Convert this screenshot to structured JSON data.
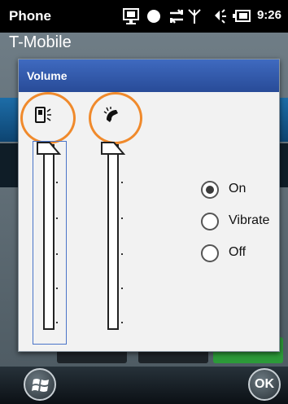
{
  "status_bar": {
    "app_name": "Phone",
    "time": "9:26",
    "icons": [
      "connection-icon",
      "status-dot-icon",
      "sync-arrows-icon",
      "signal-icon",
      "speaker-icon",
      "battery-icon"
    ]
  },
  "carrier": "T-Mobile",
  "volume_dialog": {
    "title": "Volume",
    "sliders": [
      {
        "name": "device-volume",
        "icon": "device-volume-icon",
        "level": 1.0,
        "focused": true
      },
      {
        "name": "ringer-volume",
        "icon": "phone-ringer-icon",
        "level": 1.0,
        "focused": false
      }
    ],
    "ring_mode": {
      "selected": "On",
      "options": [
        "On",
        "Vibrate",
        "Off"
      ]
    }
  },
  "soft_keys": {
    "start_icon": "windows-start-icon",
    "ok_label": "OK"
  },
  "colors": {
    "dialog_header": "#3058ac",
    "highlight_circle": "#f08a2c",
    "focus_outline": "#4a74c8"
  }
}
